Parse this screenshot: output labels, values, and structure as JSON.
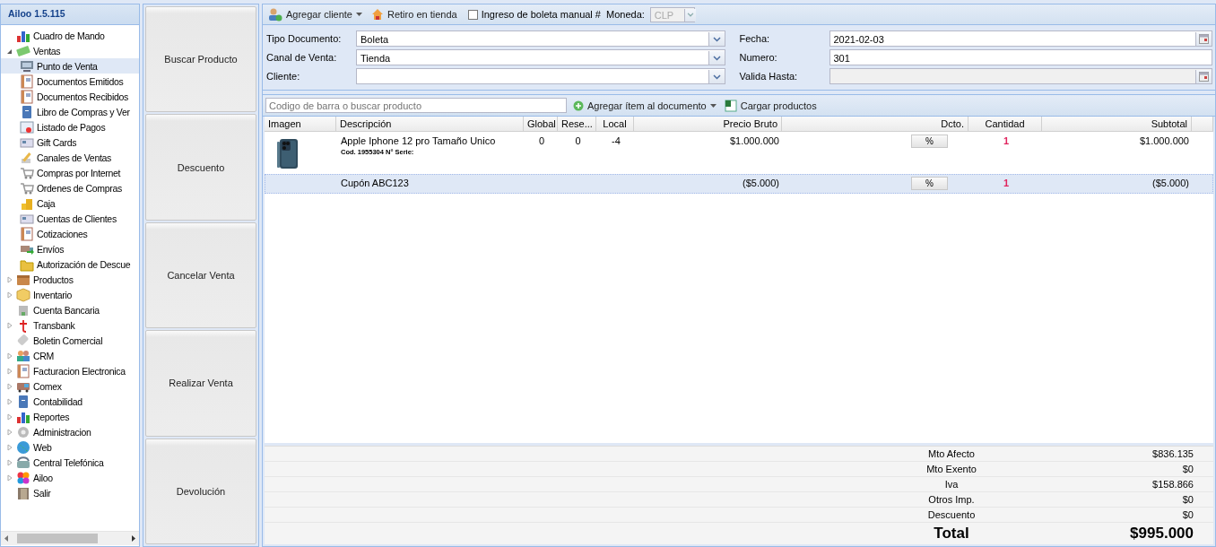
{
  "app": {
    "title": "Ailoo 1.5.115"
  },
  "nav": [
    {
      "label": "Cuadro de Mando",
      "selected": false
    },
    {
      "label": "Ventas",
      "expanded": true,
      "selected": false,
      "children": [
        {
          "label": "Punto de Venta",
          "selected": true
        },
        {
          "label": "Documentos Emitidos",
          "selected": false
        },
        {
          "label": "Documentos Recibidos",
          "selected": false
        },
        {
          "label": "Libro de Compras y Ver",
          "selected": false
        },
        {
          "label": "Listado de Pagos",
          "selected": false
        },
        {
          "label": "Gift Cards",
          "selected": false
        },
        {
          "label": "Canales de Ventas",
          "selected": false
        },
        {
          "label": "Compras por Internet",
          "selected": false
        },
        {
          "label": "Ordenes de Compras",
          "selected": false
        },
        {
          "label": "Caja",
          "selected": false
        },
        {
          "label": "Cuentas de Clientes",
          "selected": false
        },
        {
          "label": "Cotizaciones",
          "selected": false
        },
        {
          "label": "Envíos",
          "selected": false
        },
        {
          "label": "Autorización de Descue",
          "selected": false
        }
      ]
    },
    {
      "label": "Productos",
      "expanded": false,
      "selected": false
    },
    {
      "label": "Inventario",
      "expanded": false,
      "selected": false
    },
    {
      "label": "Cuenta Bancaria",
      "selected": false
    },
    {
      "label": "Transbank",
      "expanded": false,
      "selected": false
    },
    {
      "label": "Boletin Comercial",
      "selected": false
    },
    {
      "label": "CRM",
      "expanded": false,
      "selected": false
    },
    {
      "label": "Facturacion Electronica",
      "expanded": false,
      "selected": false
    },
    {
      "label": "Comex",
      "expanded": false,
      "selected": false
    },
    {
      "label": "Contabilidad",
      "expanded": false,
      "selected": false
    },
    {
      "label": "Reportes",
      "expanded": false,
      "selected": false
    },
    {
      "label": "Administracion",
      "expanded": false,
      "selected": false
    },
    {
      "label": "Web",
      "expanded": false,
      "selected": false
    },
    {
      "label": "Central Telefónica",
      "expanded": false,
      "selected": false
    },
    {
      "label": "Ailoo",
      "expanded": false,
      "selected": false
    },
    {
      "label": "Salir",
      "selected": false
    }
  ],
  "actions": [
    "Buscar Producto",
    "Descuento",
    "Cancelar Venta",
    "Realizar Venta",
    "Devolución"
  ],
  "toolbar": {
    "add_client": "Agregar cliente",
    "pickup": "Retiro en tienda",
    "manual_receipt": {
      "label": "Ingreso de boleta manual #",
      "checked": false
    },
    "currency_label": "Moneda:",
    "currency": {
      "value": "CLP",
      "disabled": true
    }
  },
  "form": {
    "left": [
      {
        "label": "Tipo Documento:",
        "value": "Boleta",
        "kind": "combo",
        "disabled": false
      },
      {
        "label": "Canal de Venta:",
        "value": "Tienda",
        "kind": "combo",
        "disabled": false
      },
      {
        "label": "Cliente:",
        "kind": "combo",
        "disabled": false
      }
    ],
    "right": [
      {
        "label": "Fecha:",
        "value": "2021-02-03",
        "kind": "date",
        "disabled": false
      },
      {
        "label": "Numero:",
        "value": "301",
        "kind": "text",
        "disabled": false
      },
      {
        "label": "Valida Hasta:",
        "kind": "date",
        "disabled": true
      }
    ]
  },
  "search": {
    "placeholder": "Codigo de barra o buscar producto",
    "add_item": "Agregar ítem al documento",
    "load": "Cargar productos"
  },
  "grid": {
    "columns": [
      "Imagen",
      "Descripción",
      "Global",
      "Rese...",
      "Local",
      "Precio Bruto",
      "Dcto.",
      "Cantidad",
      "Subtotal"
    ],
    "rows": [
      {
        "kind": "product",
        "description": "Apple Iphone 12 pro Tamaño Unico",
        "code": "Cod. 1955304 N° Serie:",
        "global": "0",
        "reserved": "0",
        "local": "-4",
        "price": "$1.000.000",
        "discount": "%",
        "quantity": "1",
        "subtotal": "$1.000.000",
        "selected": false
      },
      {
        "kind": "coupon",
        "description": "Cupón ABC123",
        "price": "($5.000)",
        "discount": "%",
        "quantity": "1",
        "subtotal": "($5.000)",
        "selected": true
      }
    ]
  },
  "totals": [
    {
      "label": "Mto Afecto",
      "value": "$836.135"
    },
    {
      "label": "Mto Exento",
      "value": "$0"
    },
    {
      "label": "Iva",
      "value": "$158.866"
    },
    {
      "label": "Otros Imp.",
      "value": "$0"
    },
    {
      "label": "Descuento",
      "value": "$0"
    }
  ],
  "total": {
    "label": "Total",
    "value": "$995.000"
  }
}
